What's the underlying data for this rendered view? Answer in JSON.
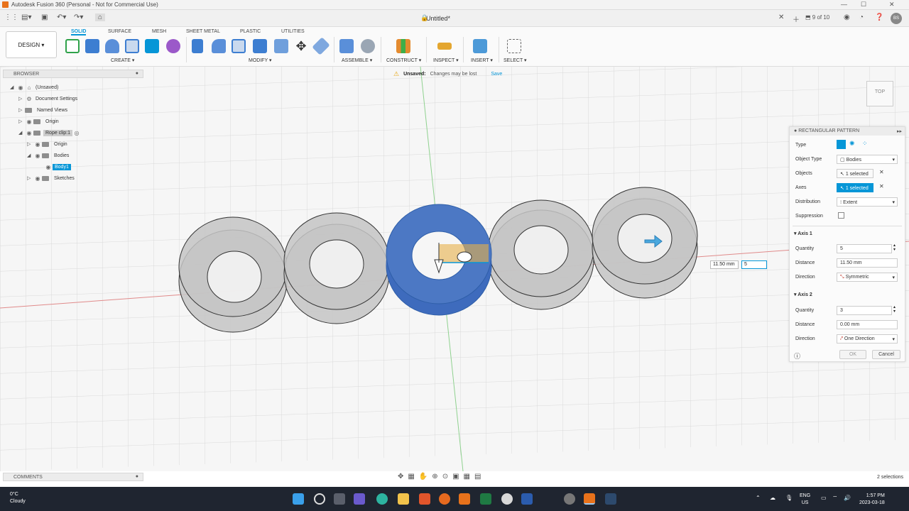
{
  "window": {
    "title": "Autodesk Fusion 360 (Personal - Not for Commercial Use)"
  },
  "appbar": {
    "document": "Untitled*",
    "page_count": "9 of 10",
    "user_initials": "BS"
  },
  "ribbon": {
    "workspace": "DESIGN",
    "tabs": [
      "SOLID",
      "SURFACE",
      "MESH",
      "SHEET METAL",
      "PLASTIC",
      "UTILITIES"
    ],
    "groups": [
      "CREATE",
      "MODIFY",
      "ASSEMBLE",
      "CONSTRUCT",
      "INSPECT",
      "INSERT",
      "SELECT"
    ]
  },
  "banner": {
    "status": "Unsaved:",
    "message": "Changes may be lost",
    "action": "Save"
  },
  "browser": {
    "title": "BROWSER",
    "nodes": [
      "(Unsaved)",
      "Document Settings",
      "Named Views",
      "Origin",
      "Rope clip:1",
      "Origin",
      "Bodies",
      "Body1",
      "Sketches"
    ]
  },
  "viewcube": {
    "label": "TOP"
  },
  "panel": {
    "title": "RECTANGULAR PATTERN",
    "type_label": "Type",
    "object_type_label": "Object Type",
    "object_type": "Bodies",
    "objects_label": "Objects",
    "objects": "1 selected",
    "axes_label": "Axes",
    "axes": "1 selected",
    "distribution_label": "Distribution",
    "distribution": "Extent",
    "suppression_label": "Suppression",
    "axis1": {
      "title": "Axis 1",
      "quantity_label": "Quantity",
      "quantity": "5",
      "distance_label": "Distance",
      "distance": "11.50 mm",
      "direction_label": "Direction",
      "direction": "Symmetric"
    },
    "axis2": {
      "title": "Axis 2",
      "quantity_label": "Quantity",
      "quantity": "3",
      "distance_label": "Distance",
      "distance": "0.00 mm",
      "direction_label": "Direction",
      "direction": "One Direction"
    },
    "ok": "OK",
    "cancel": "Cancel"
  },
  "dimension_tip": {
    "distance": "11.50 mm",
    "quantity": "5"
  },
  "comments": {
    "title": "COMMENTS"
  },
  "status": {
    "selections": "2 selections"
  },
  "taskbar": {
    "temperature": "0°C",
    "weather": "Cloudy",
    "lang": "ENG",
    "region": "US",
    "time": "1:57 PM",
    "date": "2023-03-18"
  },
  "colors": {
    "accent": "#0696d7",
    "selected_body": "#4c78c4",
    "pattern_body": "#c4c4c4",
    "taskbar": "#1f2530"
  }
}
